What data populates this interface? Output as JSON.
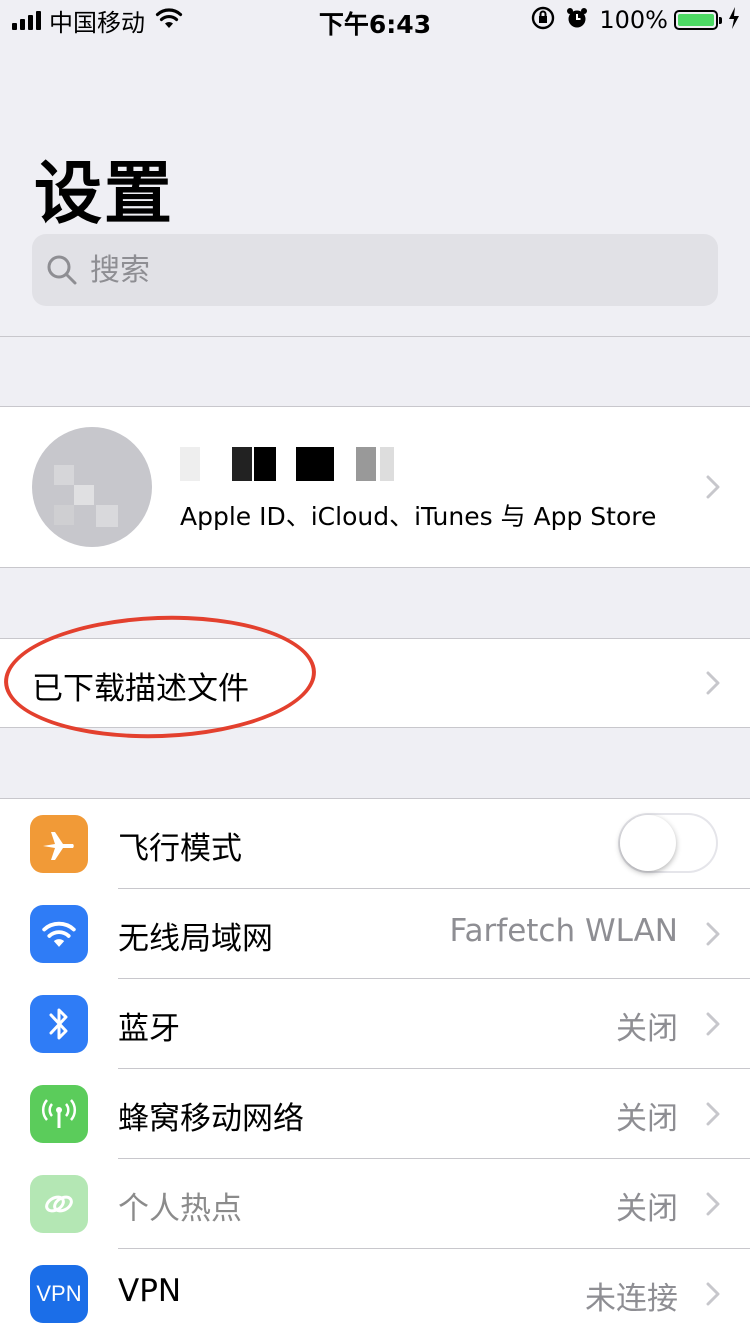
{
  "status_bar": {
    "carrier": "中国移动",
    "time": "下午6:43",
    "battery_percent": "100%",
    "battery_level": 1.0,
    "icons": [
      "signal-icon",
      "wifi-icon",
      "orientation-lock-icon",
      "alarm-icon",
      "battery-icon",
      "charging-icon"
    ]
  },
  "header": {
    "title": "设置"
  },
  "search": {
    "placeholder": "搜索"
  },
  "profile": {
    "subtitle": "Apple ID、iCloud、iTunes 与 App Store"
  },
  "downloaded_profile": {
    "label": "已下载描述文件"
  },
  "settings": [
    {
      "label": "飞行模式",
      "icon": "airplane-icon",
      "color": "#f19a37",
      "toggle": false
    },
    {
      "label": "无线局域网",
      "icon": "wifi-icon",
      "color": "#2f7cf6",
      "value": "Farfetch WLAN"
    },
    {
      "label": "蓝牙",
      "icon": "bluetooth-icon",
      "color": "#2f7cf6",
      "value": "关闭"
    },
    {
      "label": "蜂窝移动网络",
      "icon": "cellular-icon",
      "color": "#5bcc5b",
      "value": "关闭"
    },
    {
      "label": "个人热点",
      "icon": "hotspot-icon",
      "color": "#5bcc5b",
      "value": "关闭",
      "disabled": true
    },
    {
      "label": "VPN",
      "icon": "vpn-icon",
      "color": "#1b6ee8",
      "value": "未连接",
      "badge": "VPN"
    }
  ],
  "colors": {
    "accent_highlight": "#e3402e",
    "group_bg": "#efeff4",
    "toggle_on": "#4cd964"
  }
}
